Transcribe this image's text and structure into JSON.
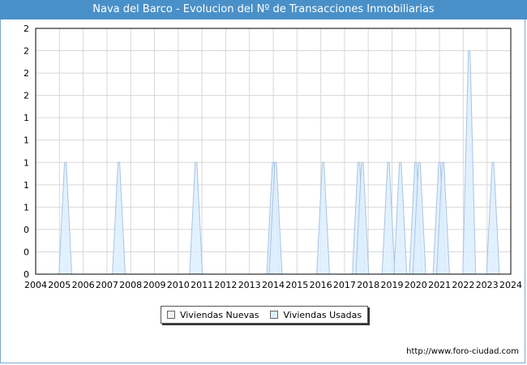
{
  "title": "Nava del Barco - Evolucion del Nº de Transacciones Inmobiliarias",
  "footer": "http://www.foro-ciudad.com",
  "colors": {
    "title_bg": "#4a90c8",
    "nuevas_fill": "#f2f2f2",
    "usadas_fill": "#ddeeff",
    "usadas_stroke": "#a9c4e0",
    "grid": "#d8d8d8"
  },
  "chart_data": {
    "type": "area",
    "title": "Nava del Barco - Evolucion del Nº de Transacciones Inmobiliarias",
    "xlabel": "",
    "ylabel": "",
    "x_ticks": [
      "2004",
      "2005",
      "2006",
      "2007",
      "2008",
      "2009",
      "2010",
      "2011",
      "2012",
      "2013",
      "2014",
      "2015",
      "2016",
      "2017",
      "2018",
      "2019",
      "2020",
      "2021",
      "2022",
      "2023",
      "2024"
    ],
    "y_ticks": [
      "0",
      "0",
      "0",
      "1",
      "1",
      "1",
      "1",
      "1",
      "2",
      "2",
      "2",
      "2"
    ],
    "ylim": [
      0,
      2.2
    ],
    "xlim": [
      2004,
      2024
    ],
    "grid": true,
    "legend_position": "bottom",
    "series": [
      {
        "name": "Viviendas Nuevas",
        "points": []
      },
      {
        "name": "Viviendas Usadas",
        "points": [
          {
            "x": 2005.25,
            "y": 1
          },
          {
            "x": 2007.5,
            "y": 1
          },
          {
            "x": 2010.75,
            "y": 1
          },
          {
            "x": 2014.0,
            "y": 1
          },
          {
            "x": 2014.1,
            "y": 1
          },
          {
            "x": 2016.1,
            "y": 1
          },
          {
            "x": 2017.6,
            "y": 1
          },
          {
            "x": 2017.75,
            "y": 1
          },
          {
            "x": 2018.85,
            "y": 1
          },
          {
            "x": 2019.35,
            "y": 1
          },
          {
            "x": 2020.0,
            "y": 1
          },
          {
            "x": 2020.15,
            "y": 1
          },
          {
            "x": 2021.0,
            "y": 1
          },
          {
            "x": 2021.15,
            "y": 1
          },
          {
            "x": 2022.25,
            "y": 2
          },
          {
            "x": 2023.25,
            "y": 1
          }
        ]
      }
    ]
  }
}
